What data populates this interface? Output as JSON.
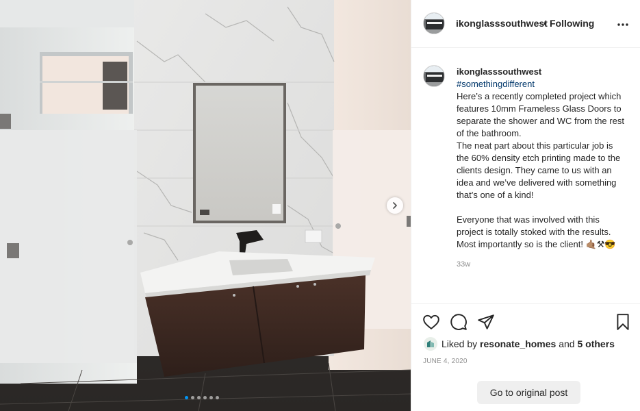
{
  "post": {
    "username": "ikonglasssouthwest",
    "separator": "•",
    "follow_label": "Following",
    "caption": {
      "username": "ikonglasssouthwest",
      "hashtag": "#somethingdifferent",
      "body": "Here’s a recently completed project which features 10mm Frameless Glass Doors to separate the shower and WC from the rest of the bathroom.\nThe neat part about this particular job is the 60% density etch printing made to the clients design. They came to us with an idea and we’ve delivered with something that’s one of a kind!\n\nEveryone that was involved with this project is totally stoked with the results. Most importantly so is the client! 🤙🏽⚒😎",
      "time_ago": "33w"
    },
    "likes": {
      "prefix": "Liked by",
      "user": "resonate_homes",
      "joiner": "and",
      "others": "5 others"
    },
    "date": "JUNE 4, 2020",
    "goto_label": "Go to original post"
  },
  "carousel": {
    "total": 6,
    "active_index": 0
  },
  "icons": {
    "more": "more-options-icon",
    "like": "heart-icon",
    "comment": "comment-icon",
    "share": "share-icon",
    "save": "bookmark-icon",
    "next": "chevron-right-icon"
  },
  "colors": {
    "link": "#00376b",
    "muted": "#8e8e8e",
    "active_dot": "#0095f6"
  }
}
